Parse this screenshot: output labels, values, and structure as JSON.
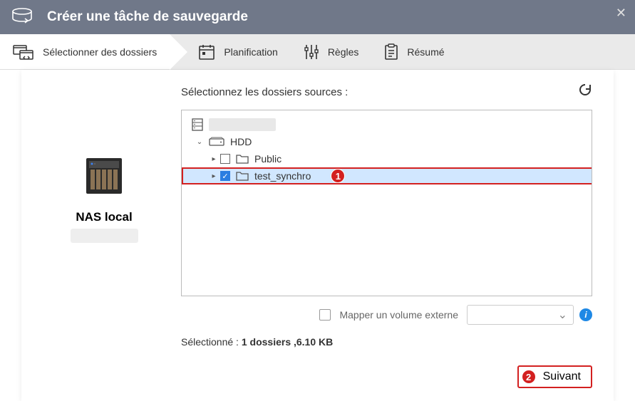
{
  "titlebar": {
    "title": "Créer une tâche de sauvegarde"
  },
  "steps": {
    "select": "Sélectionner des dossiers",
    "schedule": "Planification",
    "rules": "Règles",
    "summary": "Résumé"
  },
  "left": {
    "device_name": "NAS local"
  },
  "main": {
    "prompt": "Sélectionnez les dossiers sources :",
    "tree": {
      "hdd": "HDD",
      "public": "Public",
      "test_synchro": "test_synchro"
    },
    "badge1": "1",
    "map_label": "Mapper un volume externe",
    "selected_prefix": "Sélectionné : ",
    "selected_value": "1 dossiers ,6.10 KB"
  },
  "footer": {
    "badge2": "2",
    "next": "Suivant"
  }
}
